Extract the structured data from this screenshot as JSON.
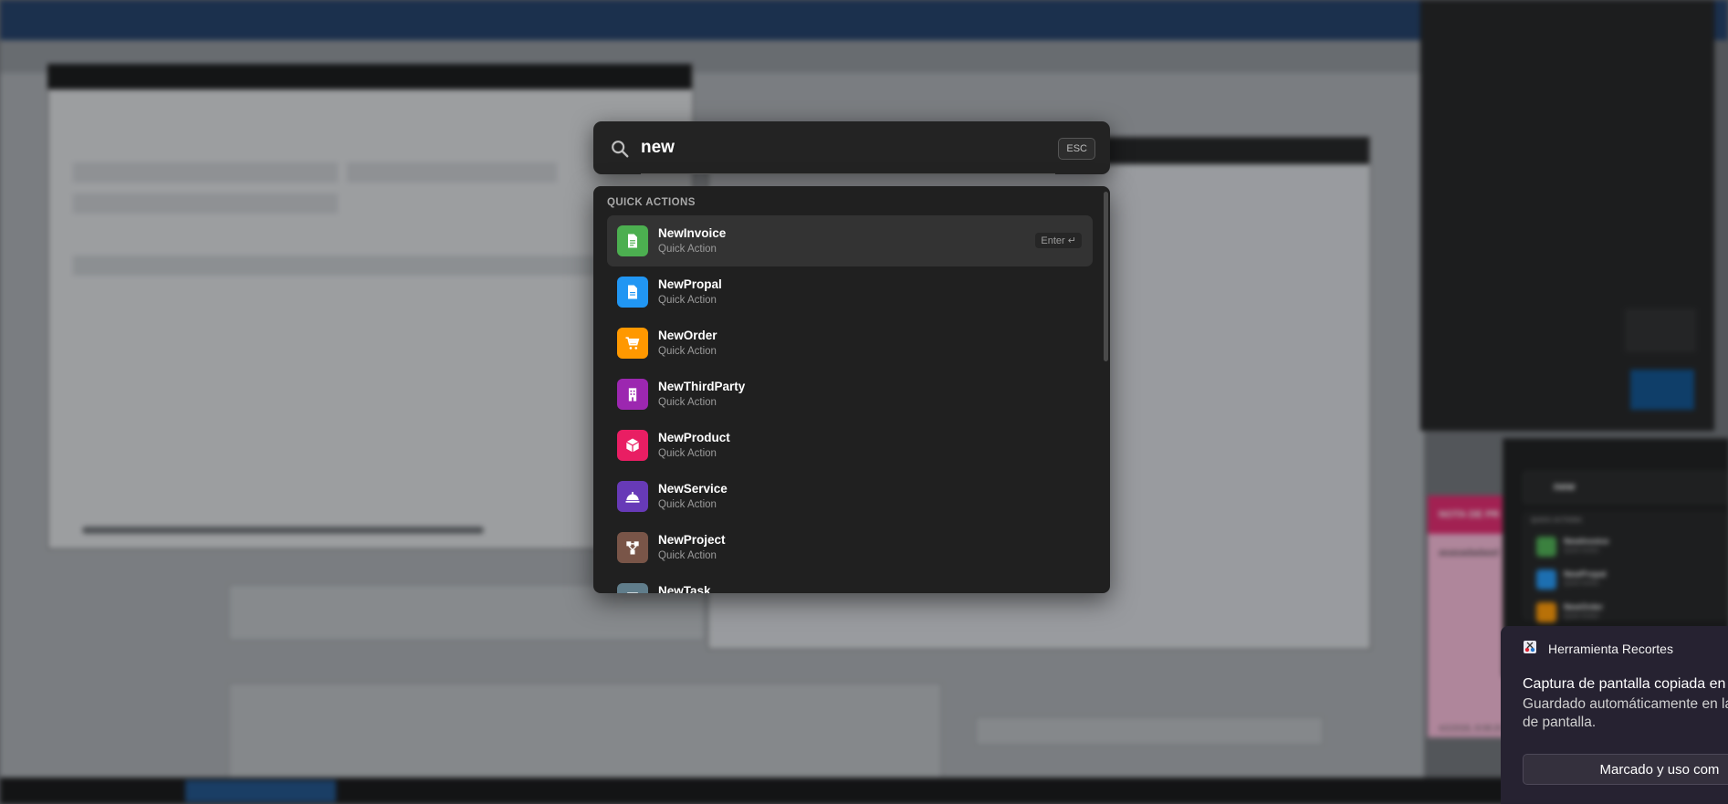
{
  "palette": {
    "query": "new",
    "esc_label": "ESC",
    "section_title": "QUICK ACTIONS",
    "enter_hint": "Enter ↵",
    "items": [
      {
        "name": "NewInvoice",
        "sub": "Quick Action",
        "color": "#4CAF50",
        "icon": "invoice-icon"
      },
      {
        "name": "NewPropal",
        "sub": "Quick Action",
        "color": "#2196F3",
        "icon": "proposal-icon"
      },
      {
        "name": "NewOrder",
        "sub": "Quick Action",
        "color": "#FF9800",
        "icon": "cart-icon"
      },
      {
        "name": "NewThirdParty",
        "sub": "Quick Action",
        "color": "#9C27B0",
        "icon": "building-icon"
      },
      {
        "name": "NewProduct",
        "sub": "Quick Action",
        "color": "#E91E63",
        "icon": "box-icon"
      },
      {
        "name": "NewService",
        "sub": "Quick Action",
        "color": "#673AB7",
        "icon": "service-bell-icon"
      },
      {
        "name": "NewProject",
        "sub": "Quick Action",
        "color": "#795548",
        "icon": "project-tree-icon"
      },
      {
        "name": "NewTask",
        "sub": "",
        "color": "#607D8B",
        "icon": "task-icon"
      }
    ]
  },
  "sticky_note": {
    "header": "NOTA DE PR",
    "body": "asasadadasd",
    "timestamp": "4/2/2026, 8:08:25"
  },
  "mini_palette": {
    "query": "new",
    "section_title": "QUICK ACTIONS",
    "items": [
      {
        "name": "NewInvoice",
        "sub": "Quick Action"
      },
      {
        "name": "NewPropal",
        "sub": "Quick Action"
      },
      {
        "name": "NewOrder",
        "sub": "Quick Action"
      }
    ]
  },
  "toast": {
    "app_name": "Herramienta Recortes",
    "title": "Captura de pantalla copiada en e",
    "body": "Guardado automáticamente en la de pantalla.",
    "action": "Marcado y uso com"
  }
}
